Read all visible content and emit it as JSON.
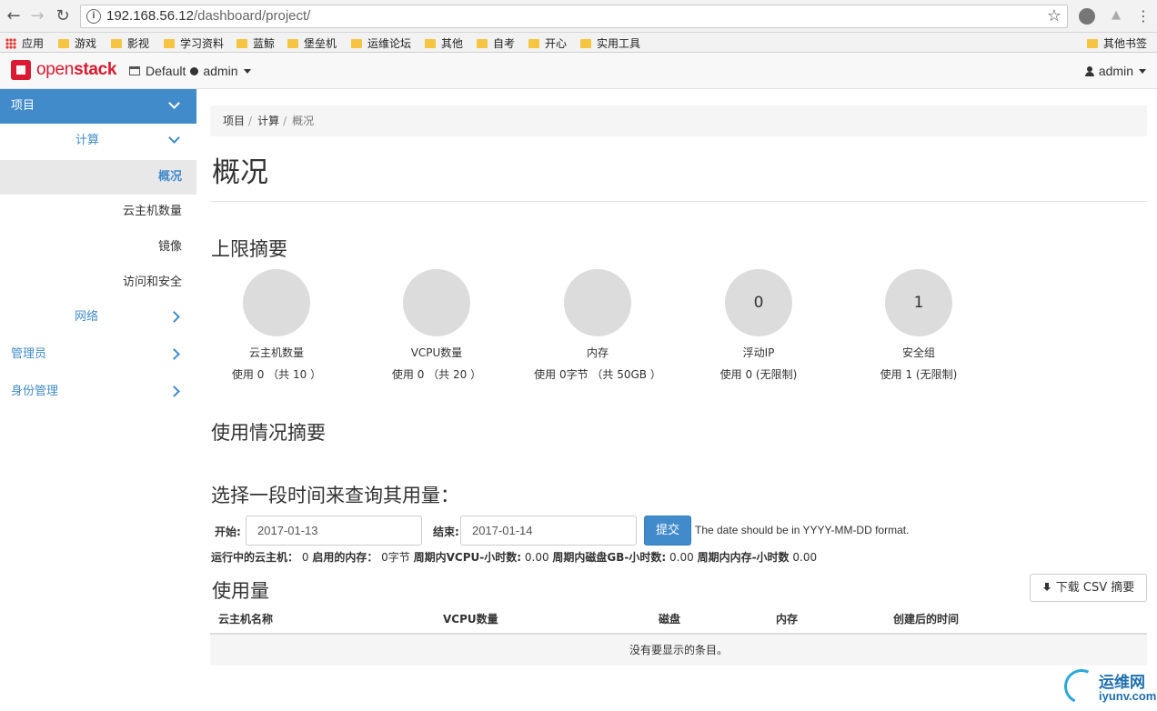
{
  "browser": {
    "url_host": "192.168.56.12",
    "url_path": "/dashboard/project/",
    "bookmarks": [
      "应用",
      "游戏",
      "影视",
      "学习资料",
      "蓝鲸",
      "堡垒机",
      "运维论坛",
      "其他",
      "自考",
      "开心",
      "实用工具"
    ],
    "other_bookmarks": "其他书签"
  },
  "header": {
    "logo_a": "open",
    "logo_b": "stack",
    "domain": "Default",
    "project": "admin",
    "user": "admin"
  },
  "sidebar": {
    "project": "项目",
    "compute": "计算",
    "overview": "概况",
    "instances": "云主机数量",
    "images": "镜像",
    "access": "访问和安全",
    "network": "网络",
    "admin": "管理员",
    "identity": "身份管理"
  },
  "breadcrumb": [
    "项目",
    "计算",
    "概况"
  ],
  "page_title": "概况",
  "limits": {
    "title": "上限摘要",
    "items": [
      {
        "value": "",
        "label": "云主机数量",
        "usage": "使用 0 （共 10 ）"
      },
      {
        "value": "",
        "label": "VCPU数量",
        "usage": "使用 0 （共 20 ）"
      },
      {
        "value": "",
        "label": "内存",
        "usage": "使用 0字节 （共 50GB ）"
      },
      {
        "value": "0",
        "label": "浮动IP",
        "usage": "使用 0 (无限制)"
      },
      {
        "value": "1",
        "label": "安全组",
        "usage": "使用 1 (无限制)"
      }
    ]
  },
  "usage_summary_title": "使用情况摘要",
  "query": {
    "title": "选择一段时间来查询其用量：",
    "start_label": "开始:",
    "start_value": "2017-01-13",
    "end_label": "结束:",
    "end_value": "2017-01-14",
    "submit": "提交",
    "help": "The date should be in YYYY-MM-DD format."
  },
  "stats": {
    "active_label": "运行中的云主机：",
    "active_value": "0",
    "ram_label": "启用的内存：",
    "ram_value": "0字节",
    "vcpu_label": "周期内VCPU-小时数:",
    "vcpu_value": "0.00",
    "disk_label": "周期内磁盘GB-小时数:",
    "disk_value": "0.00",
    "mem_label": "周期内内存-小时数",
    "mem_value": "0.00"
  },
  "usage": {
    "title": "使用量",
    "csv_button": "下载 CSV 摘要",
    "columns": [
      "云主机名称",
      "VCPU数量",
      "磁盘",
      "内存",
      "创建后的时间"
    ],
    "empty": "没有要显示的条目。"
  },
  "watermark": {
    "t1": "运维网",
    "t2": "iyunv.com"
  }
}
